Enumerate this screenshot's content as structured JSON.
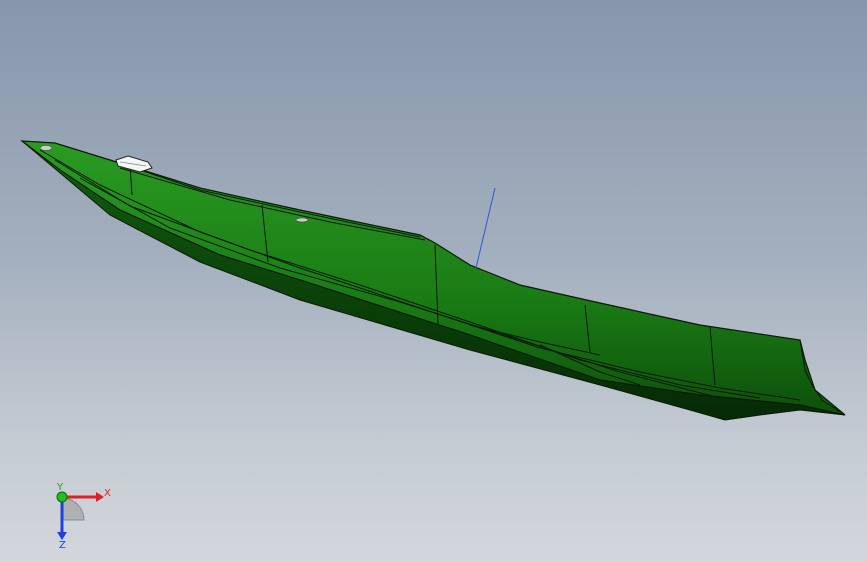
{
  "viewport": {
    "background_top": "#8796ab",
    "background_bottom": "#d3d7dc"
  },
  "model": {
    "hull_color": "#1f8a1a",
    "hull_dark": "#0f5a0c",
    "edge_color": "#0a1a08",
    "sketch_line_color": "#2a5ad8"
  },
  "triad": {
    "x_label": "X",
    "y_label": "Y",
    "z_label": "Z",
    "x_color": "#e02020",
    "y_color": "#20c020",
    "z_color": "#2040e0"
  }
}
